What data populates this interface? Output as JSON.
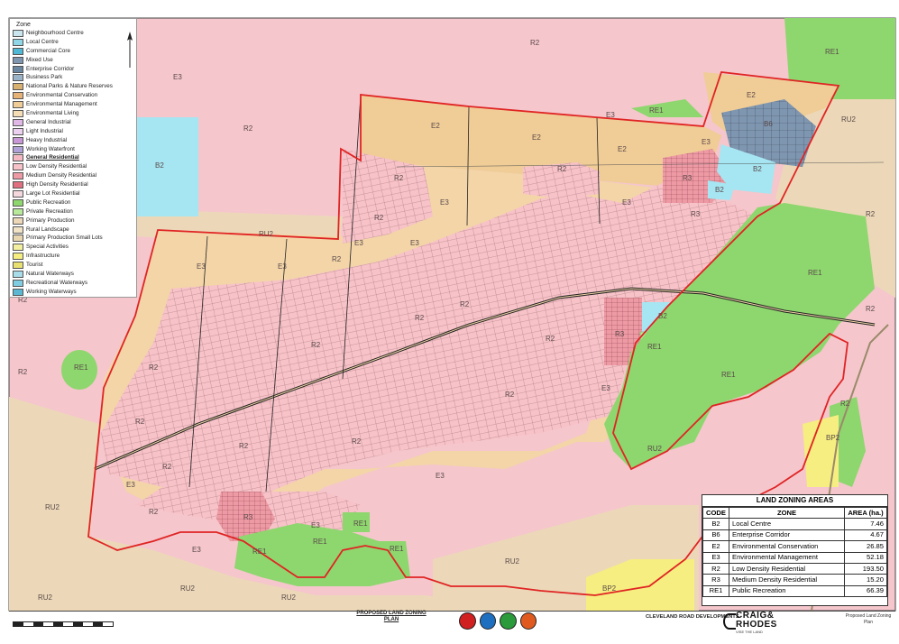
{
  "legend": {
    "title": "Zone",
    "items": [
      {
        "label": "Neighbourhood Centre",
        "color": "#c9e6ee"
      },
      {
        "label": "Local Centre",
        "color": "#8fd6e6"
      },
      {
        "label": "Commercial Core",
        "color": "#4fb8d4"
      },
      {
        "label": "Mixed Use",
        "color": "#7f96b0"
      },
      {
        "label": "Enterprise Corridor",
        "color": "#6b86a0"
      },
      {
        "label": "Business Park",
        "color": "#9bb3c6"
      },
      {
        "label": "National Parks & Nature Reserves",
        "color": "#d8b070"
      },
      {
        "label": "Environmental Conservation",
        "color": "#e6b276"
      },
      {
        "label": "Environmental Management",
        "color": "#f0cc96"
      },
      {
        "label": "Environmental Living",
        "color": "#f5ddb5"
      },
      {
        "label": "General Industrial",
        "color": "#e0b8e6"
      },
      {
        "label": "Light Industrial",
        "color": "#ecd0f0"
      },
      {
        "label": "Heavy Industrial",
        "color": "#c898d6"
      },
      {
        "label": "Working Waterfront",
        "color": "#b0a0d8"
      },
      {
        "label": "General Residential",
        "color": "#f3b8c2"
      },
      {
        "label": "Low Density Residential",
        "color": "#f7c2c8"
      },
      {
        "label": "Medium Density Residential",
        "color": "#ee9aa4"
      },
      {
        "label": "High Density Residential",
        "color": "#e07080"
      },
      {
        "label": "Large Lot Residential",
        "color": "#f5d8de"
      },
      {
        "label": "Public Recreation",
        "color": "#8ed66e"
      },
      {
        "label": "Private Recreation",
        "color": "#b8e89c"
      },
      {
        "label": "Primary Production",
        "color": "#ecd8b8"
      },
      {
        "label": "Rural Landscape",
        "color": "#f1e3c6"
      },
      {
        "label": "Primary Production Small Lots",
        "color": "#e8d6b0"
      },
      {
        "label": "Special Activities",
        "color": "#f2f0a0"
      },
      {
        "label": "Infrastructure",
        "color": "#f6ee80"
      },
      {
        "label": "Tourist",
        "color": "#e8e070"
      },
      {
        "label": "Natural Waterways",
        "color": "#a8dce8"
      },
      {
        "label": "Recreational Waterways",
        "color": "#80cce0"
      },
      {
        "label": "Working Waterways",
        "color": "#5cb8d2"
      }
    ]
  },
  "zone_labels": {
    "r2": "R2",
    "re1": "RE1",
    "ru2": "RU2",
    "e2": "E2",
    "e3": "E3",
    "b2": "B2",
    "b6": "B6",
    "r3": "R3",
    "bp2": "BP2"
  },
  "zoning_table": {
    "title": "LAND ZONING AREAS",
    "headers": [
      "CODE",
      "ZONE",
      "AREA (ha.)"
    ],
    "rows": [
      {
        "code": "B2",
        "zone": "Local Centre",
        "area": "7.46"
      },
      {
        "code": "B6",
        "zone": "Enterprise Corridor",
        "area": "4.67"
      },
      {
        "code": "E2",
        "zone": "Environmental Conservation",
        "area": "26.85"
      },
      {
        "code": "E3",
        "zone": "Environmental Management",
        "area": "52.18"
      },
      {
        "code": "R2",
        "zone": "Low Density Residential",
        "area": "193.50"
      },
      {
        "code": "R3",
        "zone": "Medium Density Residential",
        "area": "15.20"
      },
      {
        "code": "RE1",
        "zone": "Public Recreation",
        "area": "66.39"
      }
    ]
  },
  "title_block": {
    "plan_title": "PROPOSED LAND ZONING PLAN",
    "project": "CLEVELAND ROAD DEVELOPMENTS",
    "brand_line1": "CRAIG&",
    "brand_line2": "RHODES",
    "brand_tagline": "VISE THE LAND",
    "sheet_title": "Proposed Land Zoning Plan"
  },
  "colors": {
    "r2": "#f7c2c8",
    "r3": "#ee9aa4",
    "re1": "#8ed66e",
    "e2": "#f0cc96",
    "e3": "#f3d5a8",
    "ru2": "#ecd8b8",
    "b2": "#a6e6f2",
    "b6": "#7f96b0",
    "boundary": "#e02424",
    "bp2": "#f6ee80"
  }
}
